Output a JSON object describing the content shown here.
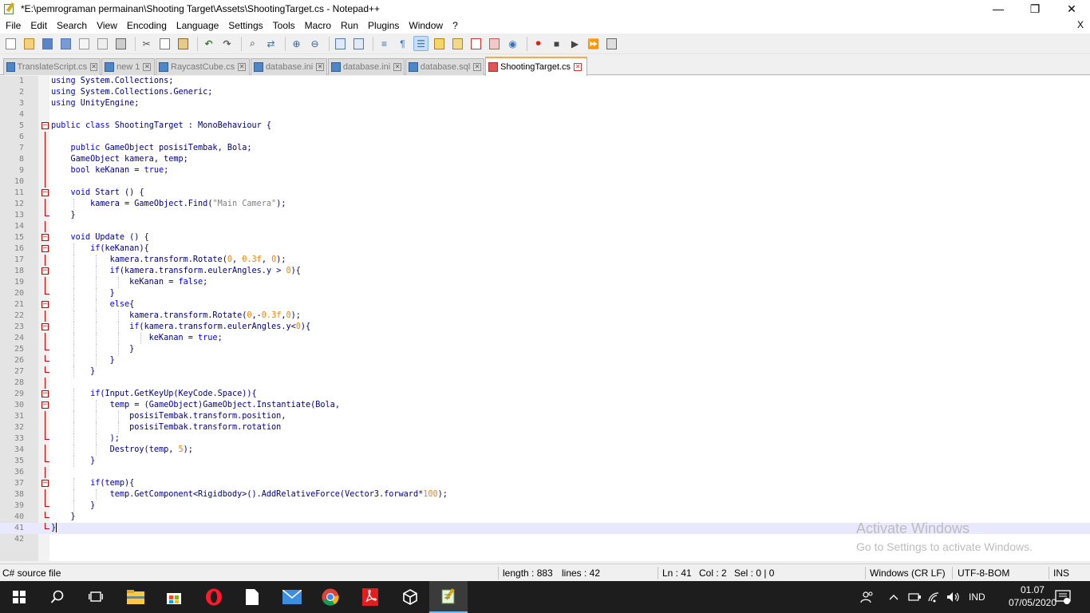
{
  "window": {
    "title": "*E:\\pemrograman permainan\\Shooting Target\\Assets\\ShootingTarget.cs - Notepad++",
    "minimize": "—",
    "maximize": "❐",
    "close": "✕"
  },
  "menu": {
    "items": [
      "File",
      "Edit",
      "Search",
      "View",
      "Encoding",
      "Language",
      "Settings",
      "Tools",
      "Macro",
      "Run",
      "Plugins",
      "Window",
      "?"
    ],
    "close": "X"
  },
  "tabs": [
    {
      "label": "TranslateScript.cs",
      "active": false,
      "icon": "file-icon-blue"
    },
    {
      "label": "new 1",
      "active": false,
      "icon": "file-icon-blue"
    },
    {
      "label": "RaycastCube.cs",
      "active": false,
      "icon": "file-icon-blue"
    },
    {
      "label": "database.ini",
      "active": false,
      "icon": "file-icon-blue"
    },
    {
      "label": "database.ini",
      "active": false,
      "icon": "file-icon-blue"
    },
    {
      "label": "database.sql",
      "active": false,
      "icon": "file-icon-blue"
    },
    {
      "label": "ShootingTarget.cs",
      "active": true,
      "icon": "file-icon-red"
    }
  ],
  "code": {
    "current_line": 41,
    "lines": [
      "using System.Collections;",
      "using System.Collections.Generic;",
      "using UnityEngine;",
      "",
      "public class ShootingTarget : MonoBehaviour {",
      "",
      "    public GameObject posisiTembak, Bola;",
      "    GameObject kamera, temp;",
      "    bool keKanan = true;",
      "",
      "    void Start () {",
      "        kamera = GameObject.Find(\"Main Camera\");",
      "    }",
      "",
      "    void Update () {",
      "        if(keKanan){",
      "            kamera.transform.Rotate(0, 0.3f, 0);",
      "            if(kamera.transform.eulerAngles.y > 0){",
      "                keKanan = false;",
      "            }",
      "            else{",
      "                kamera.transform.Rotate(0,-0.3f,0);",
      "                if(kamera.transform.eulerAngles.y<0){",
      "                    keKanan = true;",
      "                }",
      "            }",
      "        }",
      "",
      "        if(Input.GetKeyUp(KeyCode.Space)){",
      "            temp = (GameObject)GameObject.Instantiate(Bola,",
      "                posisiTembak.transform.position,",
      "                posisiTembak.transform.rotation",
      "            );",
      "            Destroy(temp, 5);",
      "        }",
      "",
      "        if(temp){",
      "            temp.GetComponent<Rigidbody>().AddRelativeForce(Vector3.forward*100);",
      "        }",
      "    }",
      "}",
      ""
    ]
  },
  "watermark": {
    "line1": "Activate Windows",
    "line2": "Go to Settings to activate Windows."
  },
  "status": {
    "filetype": "C# source file",
    "length": "length : 883",
    "lines": "lines : 42",
    "ln": "Ln : 41",
    "col": "Col : 2",
    "sel": "Sel : 0 | 0",
    "eol": "Windows (CR LF)",
    "encoding": "UTF-8-BOM",
    "mode": "INS"
  },
  "taskbar": {
    "language": "IND",
    "time": "01.07",
    "date": "07/05/2020"
  }
}
